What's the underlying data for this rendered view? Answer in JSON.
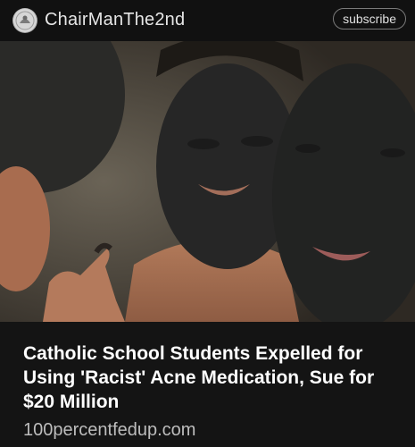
{
  "header": {
    "channel_name": "ChairManThe2nd",
    "subscribe_label": "subscribe",
    "avatar_icon": "avatar-logo-icon"
  },
  "article": {
    "headline": "Catholic School Students Expelled for Using 'Racist' Acne Medication, Sue for $20 Million",
    "source": "100percentfedup.com"
  },
  "colors": {
    "background": "#0d0d0d",
    "caption_background": "#141414",
    "headline_text": "#ffffff",
    "source_text": "#bdbdbd"
  }
}
